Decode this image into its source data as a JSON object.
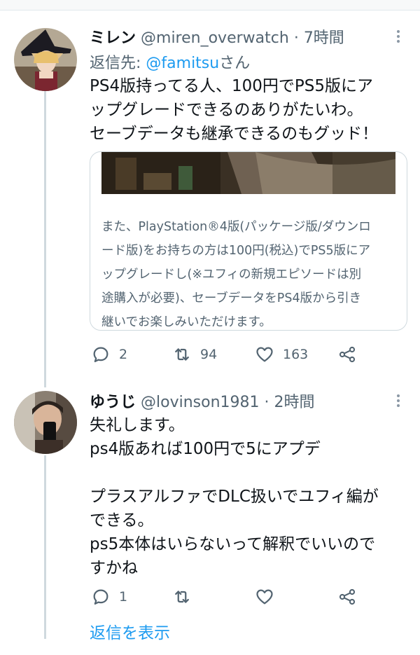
{
  "tweet1": {
    "name": "ミレン",
    "handle": "@miren_overwatch",
    "sep": "·",
    "time": "7時間",
    "replying_prefix": "返信先: ",
    "replying_mention": "@famitsu",
    "replying_suffix": "さん",
    "body_lines": [
      "PS4版持ってる人、100円でPS5版にア",
      "ップグレードできるのありがたいわ。",
      "セーブデータも継承できるのもグッド！"
    ],
    "card_lines": [
      "また、PlayStation®4版(パッケージ版/ダウンロ",
      "ード版)をお持ちの方は100円(税込)でPS5版にア",
      "ップグレードし(※ユフィの新規エピソードは別",
      "途購入が必要)、セーブデータをPS4版から引き",
      "継いでお楽しみいただけます。"
    ],
    "replies": "2",
    "retweets": "94",
    "likes": "163"
  },
  "tweet2": {
    "name": "ゆうじ",
    "handle": "@lovinson1981",
    "sep": "·",
    "time": "2時間",
    "body_lines": [
      "失礼します。",
      "ps4版あれば100円で5にアプデ",
      "",
      "プラスアルファでDLC扱いでユフィ編が",
      "できる。",
      "ps5本体はいらないって解釈でいいので",
      "すかね"
    ],
    "replies": "1",
    "retweets": "",
    "likes": ""
  },
  "show_replies": "返信を表示",
  "colors": {
    "accent": "#1d9bf0",
    "secondary": "#536471",
    "border": "#cfd9de"
  },
  "icons": [
    "reply-icon",
    "retweet-icon",
    "like-icon",
    "share-icon",
    "more-icon"
  ]
}
